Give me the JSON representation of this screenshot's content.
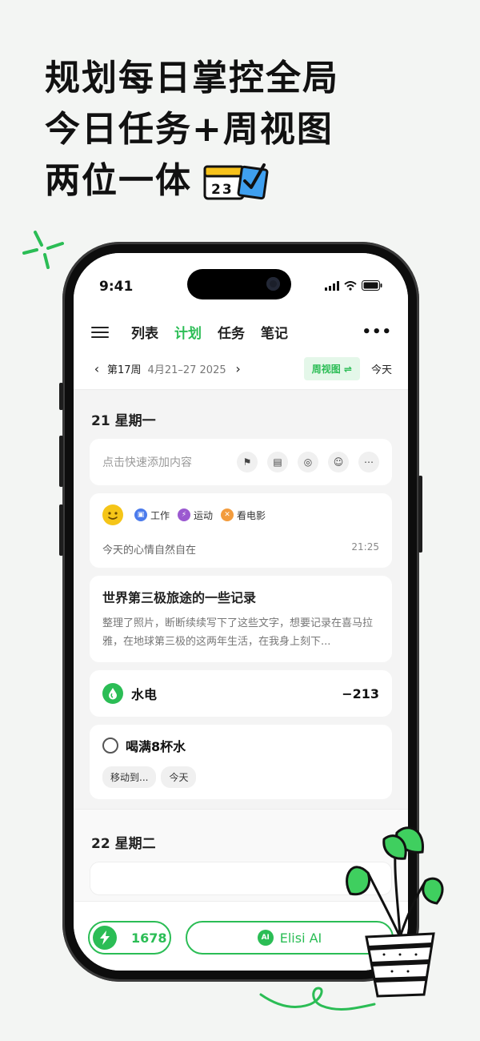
{
  "headline": {
    "line1": "规划每日掌控全局",
    "line2": "今日任务+周视图",
    "line3": "两位一体",
    "calendar_number": "23"
  },
  "status_bar": {
    "time": "9:41"
  },
  "header": {
    "tabs": [
      {
        "label": "列表",
        "active": false
      },
      {
        "label": "计划",
        "active": true
      },
      {
        "label": "任务",
        "active": false
      },
      {
        "label": "笔记",
        "active": false
      }
    ],
    "more": "•••"
  },
  "week_nav": {
    "prev": "‹",
    "week": "第17周",
    "range": "4月21–27 2025",
    "next": "›",
    "week_view_label": "周视图 ⇌",
    "today_label": "今天"
  },
  "day1": {
    "title": "21 星期一",
    "quick_add_placeholder": "点击快速添加内容",
    "mood": {
      "tags": [
        {
          "label": "工作",
          "color": "#4b7bec",
          "glyph": "▣"
        },
        {
          "label": "运动",
          "color": "#9b59d0",
          "glyph": "⚡"
        },
        {
          "label": "看电影",
          "color": "#f39c3d",
          "glyph": "✕"
        }
      ],
      "text": "今天的心情自然自在",
      "time": "21:25"
    },
    "note": {
      "title": "世界第三极旅途的一些记录",
      "body": "整理了照片，断断续续写下了这些文字，想要记录在喜马拉雅，在地球第三极的这两年生活，在我身上刻下..."
    },
    "finance": {
      "label": "水电",
      "amount": "−213"
    },
    "task": {
      "title": "喝满8杯水",
      "chips": [
        "移动到...",
        "今天"
      ]
    }
  },
  "day2": {
    "title": "22 星期二"
  },
  "bottom_bar": {
    "energy": "1678",
    "ai_badge": "AI",
    "ai_label": "Elisi AI"
  },
  "colors": {
    "accent": "#2bbd55",
    "background": "#f3f5f3"
  }
}
